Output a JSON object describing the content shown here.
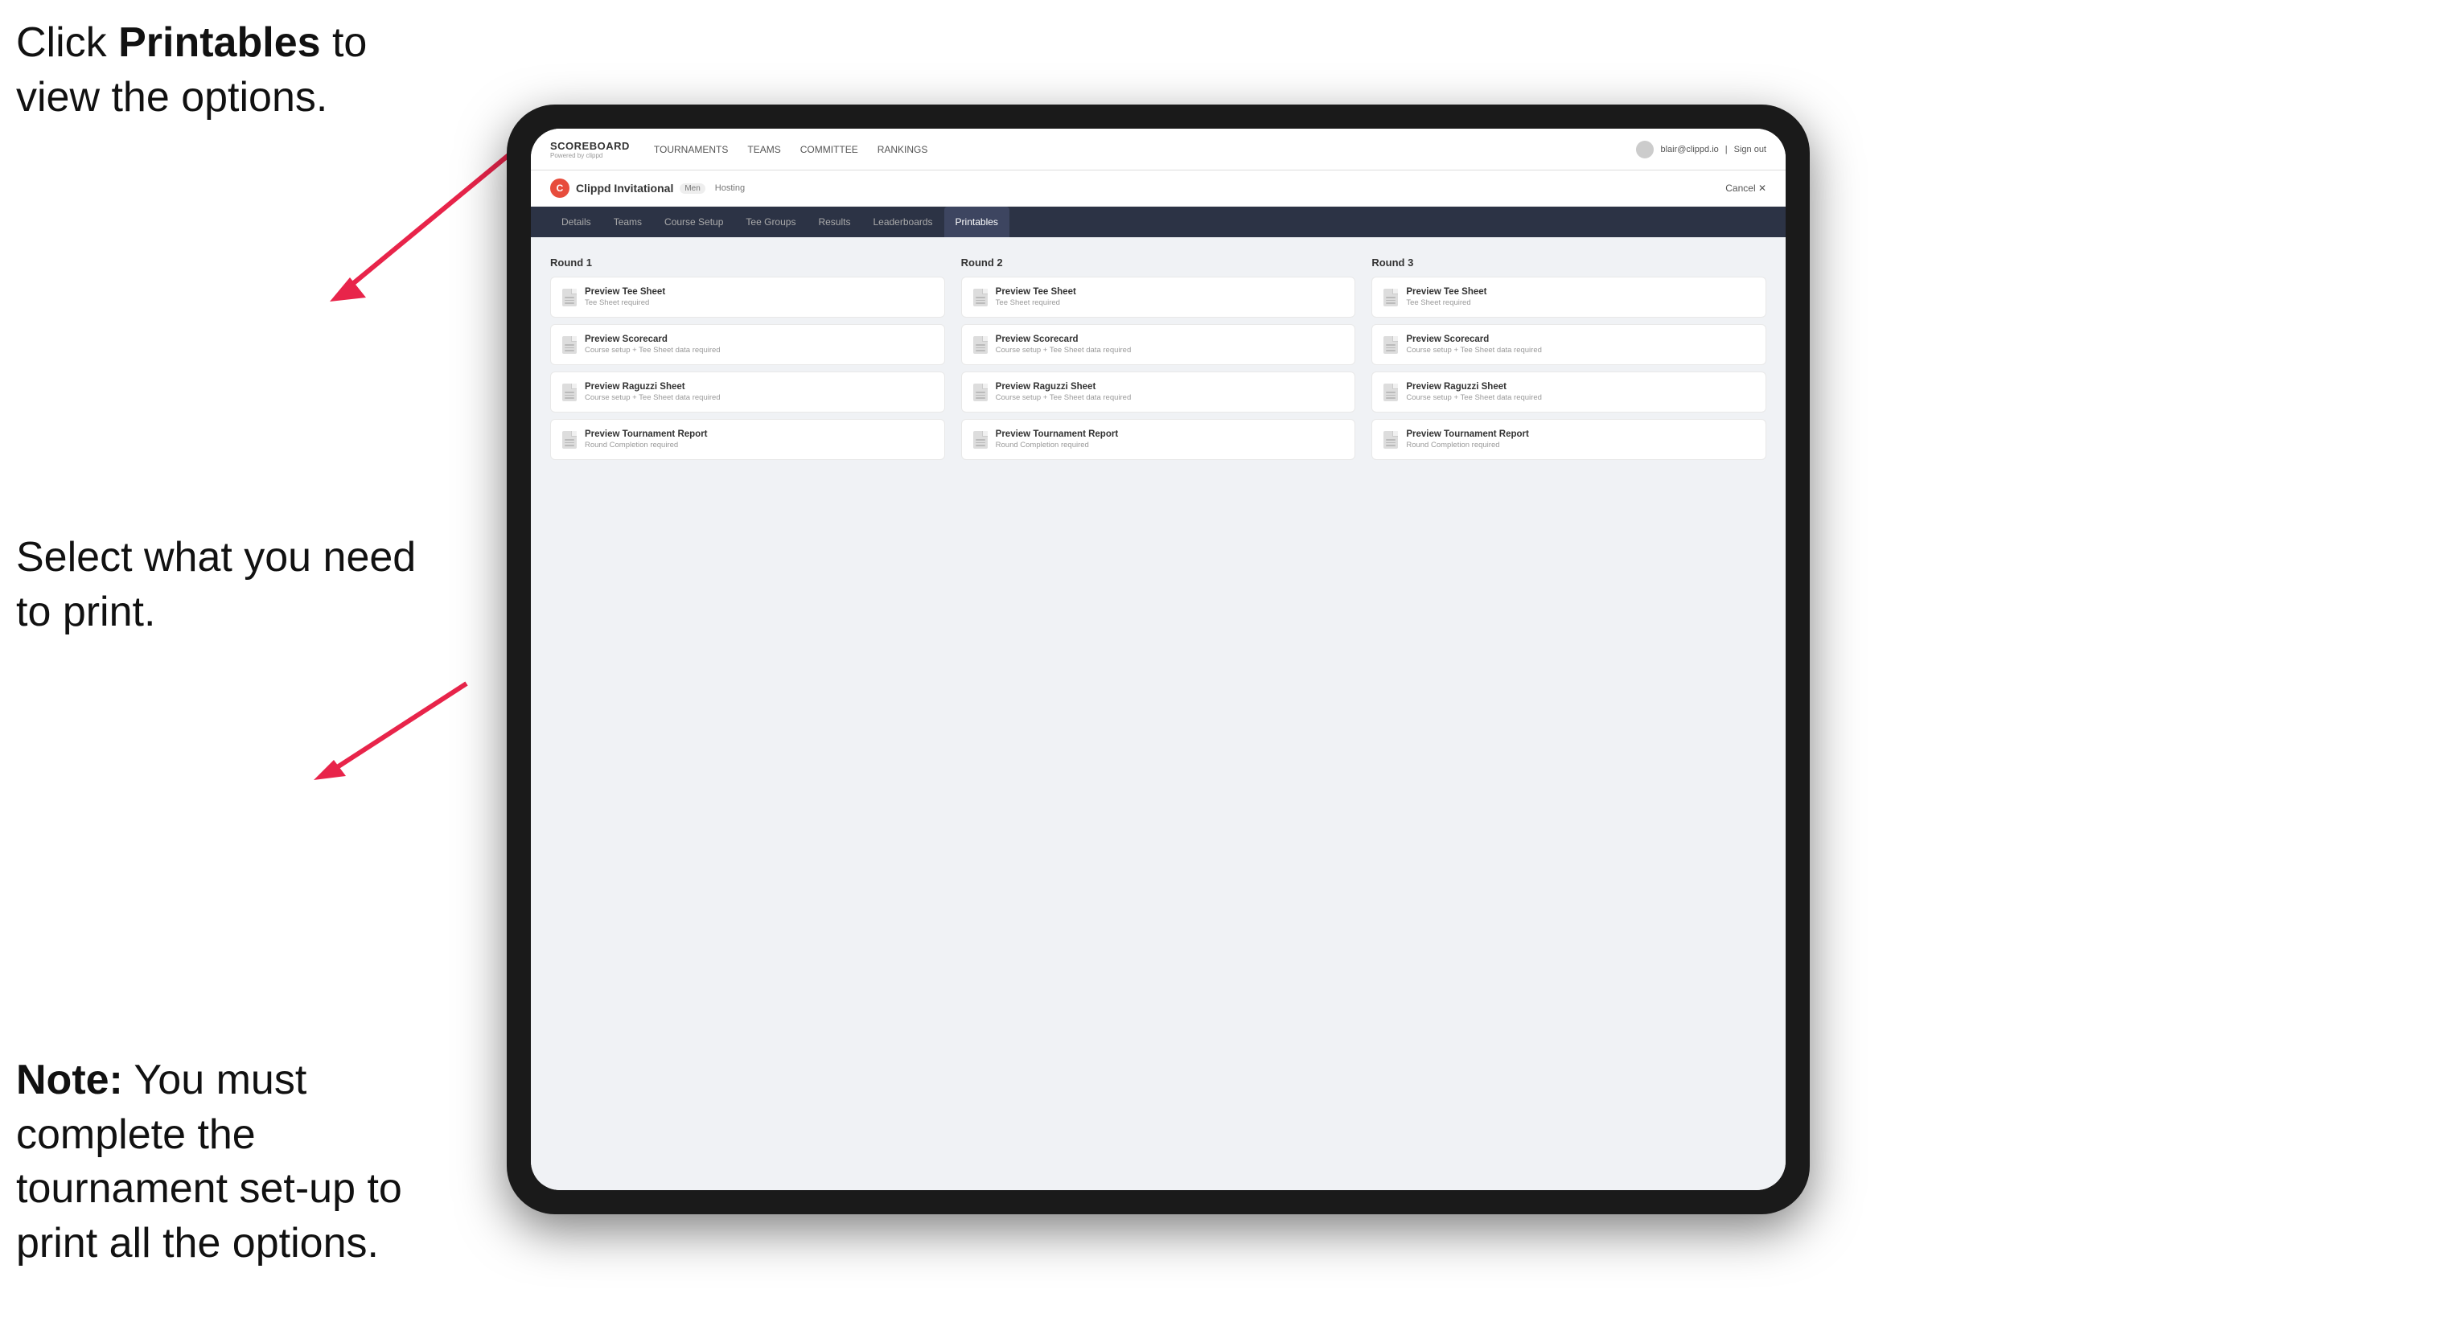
{
  "annotations": {
    "top": {
      "text_prefix": "Click ",
      "text_bold": "Printables",
      "text_suffix": " to view the options."
    },
    "middle": {
      "text": "Select what you need to print."
    },
    "bottom": {
      "text_bold": "Note:",
      "text_suffix": " You must complete the tournament set-up to print all the options."
    }
  },
  "topnav": {
    "brand": "SCOREBOARD",
    "brand_sub": "Powered by clippd",
    "items": [
      {
        "label": "TOURNAMENTS",
        "active": false
      },
      {
        "label": "TEAMS",
        "active": false
      },
      {
        "label": "COMMITTEE",
        "active": false
      },
      {
        "label": "RANKINGS",
        "active": false
      }
    ],
    "user_email": "blair@clippd.io",
    "sign_out": "Sign out"
  },
  "tournament": {
    "logo_letter": "C",
    "name": "Clippd Invitational",
    "gender_badge": "Men",
    "status": "Hosting",
    "cancel_label": "Cancel ✕"
  },
  "subnav": {
    "items": [
      {
        "label": "Details",
        "active": false
      },
      {
        "label": "Teams",
        "active": false
      },
      {
        "label": "Course Setup",
        "active": false
      },
      {
        "label": "Tee Groups",
        "active": false
      },
      {
        "label": "Results",
        "active": false
      },
      {
        "label": "Leaderboards",
        "active": false
      },
      {
        "label": "Printables",
        "active": true
      }
    ]
  },
  "rounds": [
    {
      "title": "Round 1",
      "cards": [
        {
          "title": "Preview Tee Sheet",
          "subtitle": "Tee Sheet required"
        },
        {
          "title": "Preview Scorecard",
          "subtitle": "Course setup + Tee Sheet data required"
        },
        {
          "title": "Preview Raguzzi Sheet",
          "subtitle": "Course setup + Tee Sheet data required"
        },
        {
          "title": "Preview Tournament Report",
          "subtitle": "Round Completion required"
        }
      ]
    },
    {
      "title": "Round 2",
      "cards": [
        {
          "title": "Preview Tee Sheet",
          "subtitle": "Tee Sheet required"
        },
        {
          "title": "Preview Scorecard",
          "subtitle": "Course setup + Tee Sheet data required"
        },
        {
          "title": "Preview Raguzzi Sheet",
          "subtitle": "Course setup + Tee Sheet data required"
        },
        {
          "title": "Preview Tournament Report",
          "subtitle": "Round Completion required"
        }
      ]
    },
    {
      "title": "Round 3",
      "cards": [
        {
          "title": "Preview Tee Sheet",
          "subtitle": "Tee Sheet required"
        },
        {
          "title": "Preview Scorecard",
          "subtitle": "Course setup + Tee Sheet data required"
        },
        {
          "title": "Preview Raguzzi Sheet",
          "subtitle": "Course setup + Tee Sheet data required"
        },
        {
          "title": "Preview Tournament Report",
          "subtitle": "Round Completion required"
        }
      ]
    }
  ]
}
